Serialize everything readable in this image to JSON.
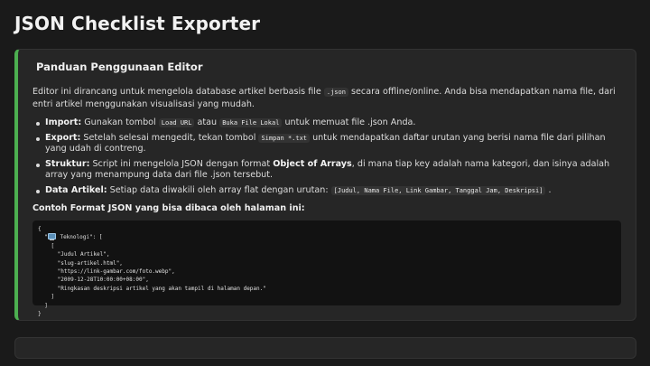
{
  "title": "JSON Checklist Exporter",
  "guide": {
    "heading": "Panduan Penggunaan Editor",
    "intro_before": "Editor ini dirancang untuk mengelola database artikel berbasis file ",
    "intro_code": ".json",
    "intro_after": " secara offline/online. Anda bisa mendapatkan nama file, dari entri artikel menggunakan visualisasi yang mudah.",
    "items": [
      {
        "label": "Import:",
        "t1": " Gunakan tombol ",
        "c1": "Load URL",
        "t2": " atau ",
        "c2": "Buka File Lokal",
        "t3": " untuk memuat file .json Anda."
      },
      {
        "label": "Export:",
        "t1": " Setelah selesai mengedit, tekan tombol ",
        "c1": "Simpan *.txt",
        "t2": " untuk mendapatkan daftar urutan yang berisi nama file dari pilihan yang udah di contreng."
      },
      {
        "label": "Struktur:",
        "t1": " Script ini mengelola JSON dengan format ",
        "bold": "Object of Arrays",
        "t2": ", di mana tiap key adalah nama kategori, dan isinya adalah array yang menampung data dari file .json tersebut."
      },
      {
        "label": "Data Artikel:",
        "t1": " Setiap data diwakili oleh array flat dengan urutan: ",
        "c1": "[Judul, Nama File, Link Gambar, Tanggal Jam, Deskripsi]",
        "t2": " ."
      }
    ],
    "example_heading": "Contoh Format JSON yang bisa dibaca oleh halaman ini:",
    "code": {
      "line1": "{",
      "line2_prefix": "  \"",
      "line2_suffix": " Teknologi\": [",
      "line3": "    [",
      "line4": "      \"Judul Artikel\",",
      "line5": "      \"slug-artikel.html\",",
      "line6": "      \"https://link-gambar.com/foto.webp\",",
      "line7": "      \"2009-12-28T10:00:00+08:00\",",
      "line8": "      \"Ringkasan deskripsi artikel yang akan tampil di halaman depan.\"",
      "line9": "    ]",
      "line10": "  ]",
      "line11": "}"
    }
  }
}
